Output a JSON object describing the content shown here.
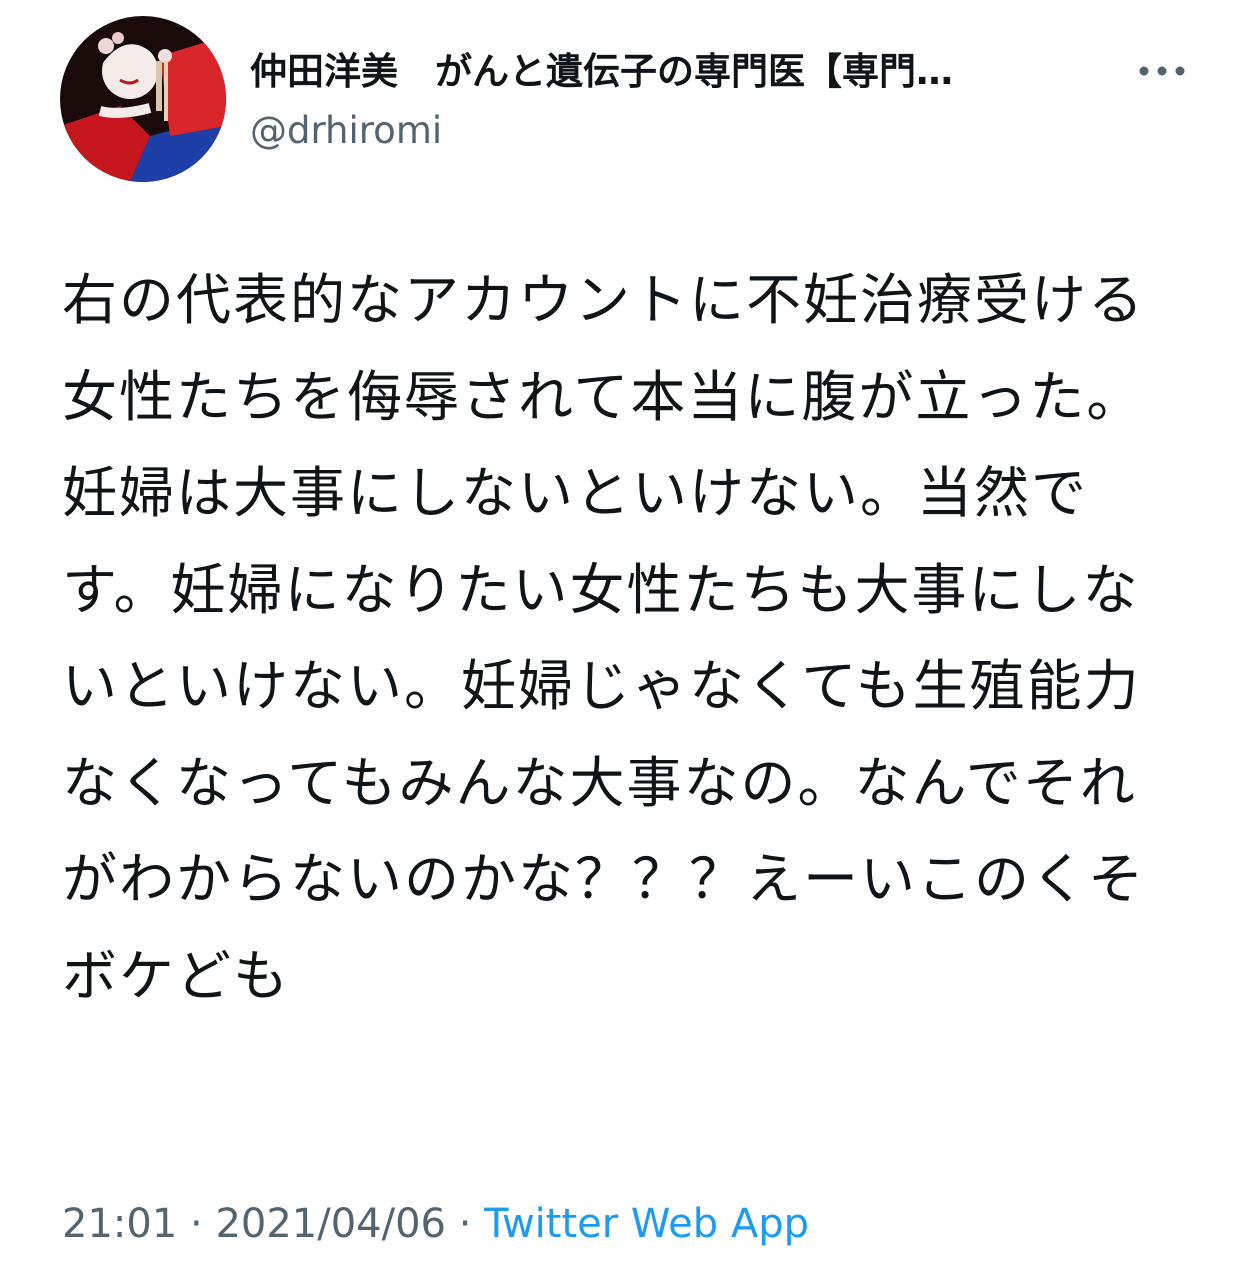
{
  "tweet": {
    "display_name": "仲田洋美　がんと遺伝子の専門医【専門…",
    "handle": "@drhiromi",
    "body": "右の代表的なアカウントに不妊治療受ける女性たちを侮辱されて本当に腹が立った。\n妊婦は大事にしないといけない。当然です。妊婦になりたい女性たちも大事にしないといけない。妊婦じゃなくても生殖能力なくなってもみんな大事なの。なんでそれがわからないのかな？？？えーいこのくそボケども",
    "time": "21:01",
    "separator": "·",
    "date": "2021/04/06",
    "source": "Twitter Web App"
  },
  "icons": {
    "more": "more-horizontal-icon",
    "avatar": "profile-avatar"
  },
  "colors": {
    "text": "#0f1419",
    "secondary": "#536471",
    "link": "#1d9bf0",
    "background": "#ffffff"
  }
}
